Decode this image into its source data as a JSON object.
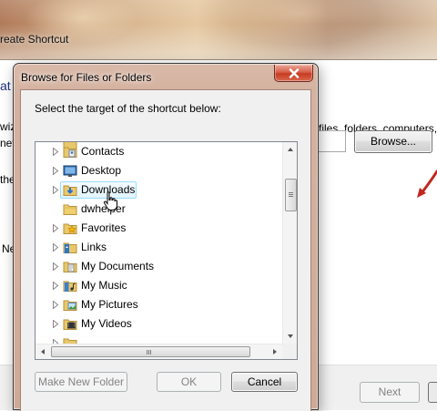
{
  "background_window": {
    "title": "reate Shortcut",
    "heading": "at",
    "desc_line1": "wiz",
    "desc_line2": "net",
    "desc_right": "files, folders, computers,",
    "field_label": "the",
    "browse_label": "Browse...",
    "next_label_partial": "Ne",
    "footer_next": "Next"
  },
  "dialog": {
    "title": "Browse for Files or Folders",
    "instruction": "Select the target of the shortcut below:",
    "tree": [
      {
        "label": "Contacts",
        "icon": "contacts-icon",
        "expandable": true,
        "selected": false
      },
      {
        "label": "Desktop",
        "icon": "desktop-icon",
        "expandable": true,
        "selected": false
      },
      {
        "label": "Downloads",
        "icon": "downloads-icon",
        "expandable": true,
        "selected": true
      },
      {
        "label": "dwhelper",
        "icon": "folder-icon",
        "expandable": false,
        "selected": false
      },
      {
        "label": "Favorites",
        "icon": "favorites-icon",
        "expandable": true,
        "selected": false
      },
      {
        "label": "Links",
        "icon": "links-icon",
        "expandable": true,
        "selected": false
      },
      {
        "label": "My Documents",
        "icon": "documents-icon",
        "expandable": true,
        "selected": false
      },
      {
        "label": "My Music",
        "icon": "music-icon",
        "expandable": true,
        "selected": false
      },
      {
        "label": "My Pictures",
        "icon": "pictures-icon",
        "expandable": true,
        "selected": false
      },
      {
        "label": "My Videos",
        "icon": "videos-icon",
        "expandable": true,
        "selected": false
      }
    ],
    "buttons": {
      "make_new_folder": "Make New Folder",
      "ok": "OK",
      "cancel": "Cancel"
    }
  },
  "colors": {
    "heading_blue": "#1e3287",
    "selection_border": "#99defd",
    "close_red": "#c63a20",
    "annotation_arrow": "#c0281e"
  }
}
